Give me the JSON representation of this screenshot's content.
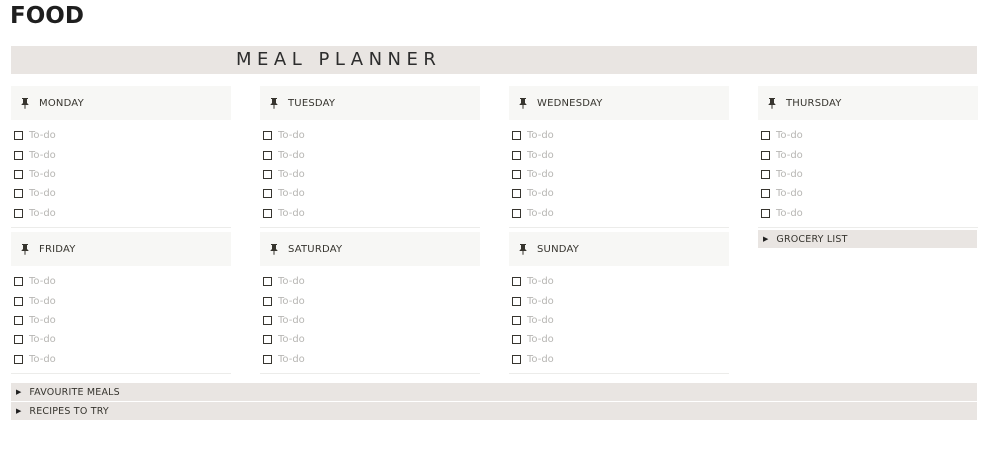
{
  "page": {
    "title": "FOOD"
  },
  "banner": {
    "title": "MEAL PLANNER"
  },
  "todo_placeholder": "To-do",
  "days": [
    {
      "label": "MONDAY",
      "todos": [
        "To-do",
        "To-do",
        "To-do",
        "To-do",
        "To-do"
      ]
    },
    {
      "label": "TUESDAY",
      "todos": [
        "To-do",
        "To-do",
        "To-do",
        "To-do",
        "To-do"
      ]
    },
    {
      "label": "WEDNESDAY",
      "todos": [
        "To-do",
        "To-do",
        "To-do",
        "To-do",
        "To-do"
      ]
    },
    {
      "label": "THURSDAY",
      "todos": [
        "To-do",
        "To-do",
        "To-do",
        "To-do",
        "To-do"
      ]
    },
    {
      "label": "FRIDAY",
      "todos": [
        "To-do",
        "To-do",
        "To-do",
        "To-do",
        "To-do"
      ]
    },
    {
      "label": "SATURDAY",
      "todos": [
        "To-do",
        "To-do",
        "To-do",
        "To-do",
        "To-do"
      ]
    },
    {
      "label": "SUNDAY",
      "todos": [
        "To-do",
        "To-do",
        "To-do",
        "To-do",
        "To-do"
      ]
    }
  ],
  "toggles": {
    "grocery_list": "GROCERY LIST",
    "favourite_meals": "FAVOURITE MEALS",
    "recipes_to_try": "RECIPES TO TRY"
  },
  "icons": {
    "day_icon": "pushpin-icon",
    "toggle_icon": "triangle-right-icon"
  },
  "colors": {
    "banner_bg": "#e9e5e2",
    "day_header_bg": "#f7f7f5",
    "placeholder_text": "#b7b6b3"
  }
}
